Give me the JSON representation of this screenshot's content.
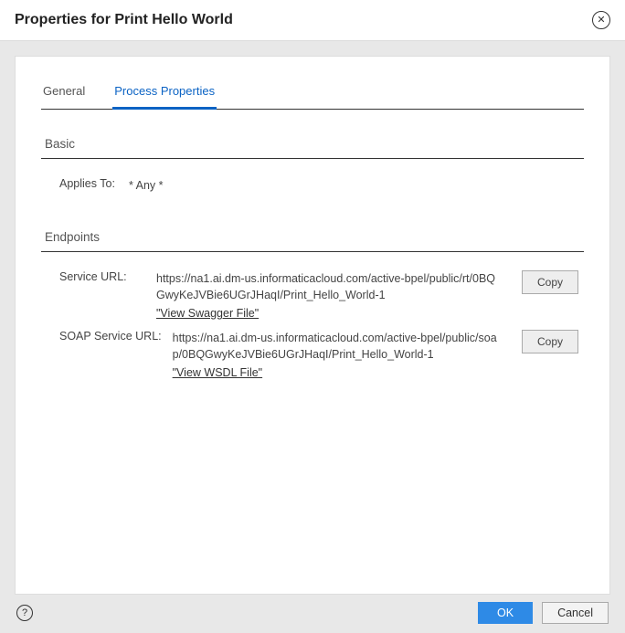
{
  "header": {
    "title": "Properties for Print Hello World"
  },
  "tabs": {
    "general": "General",
    "process_properties": "Process Properties"
  },
  "sections": {
    "basic": {
      "title": "Basic",
      "applies_to_label": "Applies To:",
      "applies_to_value": "* Any *"
    },
    "endpoints": {
      "title": "Endpoints",
      "service_url_label": "Service URL:",
      "service_url_value": "https://na1.ai.dm-us.informaticacloud.com/active-bpel/public/rt/0BQGwyKeJVBie6UGrJHaqI/Print_Hello_World-1",
      "service_url_link": "\"View Swagger File\"",
      "soap_url_label": "SOAP Service URL:",
      "soap_url_value": "https://na1.ai.dm-us.informaticacloud.com/active-bpel/public/soap/0BQGwyKeJVBie6UGrJHaqI/Print_Hello_World-1",
      "soap_url_link": "\"View WSDL File\"",
      "copy_label": "Copy"
    }
  },
  "footer": {
    "ok": "OK",
    "cancel": "Cancel"
  }
}
